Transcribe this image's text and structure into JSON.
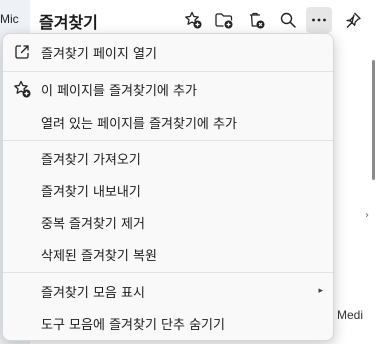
{
  "window": {
    "left_text": "Mic"
  },
  "header": {
    "title": "즐겨찾기",
    "icons": [
      "add-favorite-icon",
      "add-folder-icon",
      "delete-icon",
      "search-icon",
      "more-icon",
      "pin-icon"
    ]
  },
  "background": {
    "peek_text": "Medi"
  },
  "menu": {
    "items": [
      {
        "label": "즐겨찾기 페이지 열기",
        "icon": "open-external-icon"
      },
      {
        "label": "이 페이지를 즐겨찾기에 추가",
        "icon": "add-favorite-icon"
      },
      {
        "label": "열려 있는 페이지를 즐겨찾기에 추가"
      },
      {
        "label": "즐겨찾기 가져오기"
      },
      {
        "label": "즐겨찾기 내보내기"
      },
      {
        "label": "중복 즐겨찾기 제거"
      },
      {
        "label": "삭제된 즐겨찾기 복원"
      },
      {
        "label": "즐겨찾기 모음 표시",
        "submenu_arrow": "▸"
      },
      {
        "label": "도구 모음에 즐겨찾기 단추 숨기기"
      }
    ]
  }
}
